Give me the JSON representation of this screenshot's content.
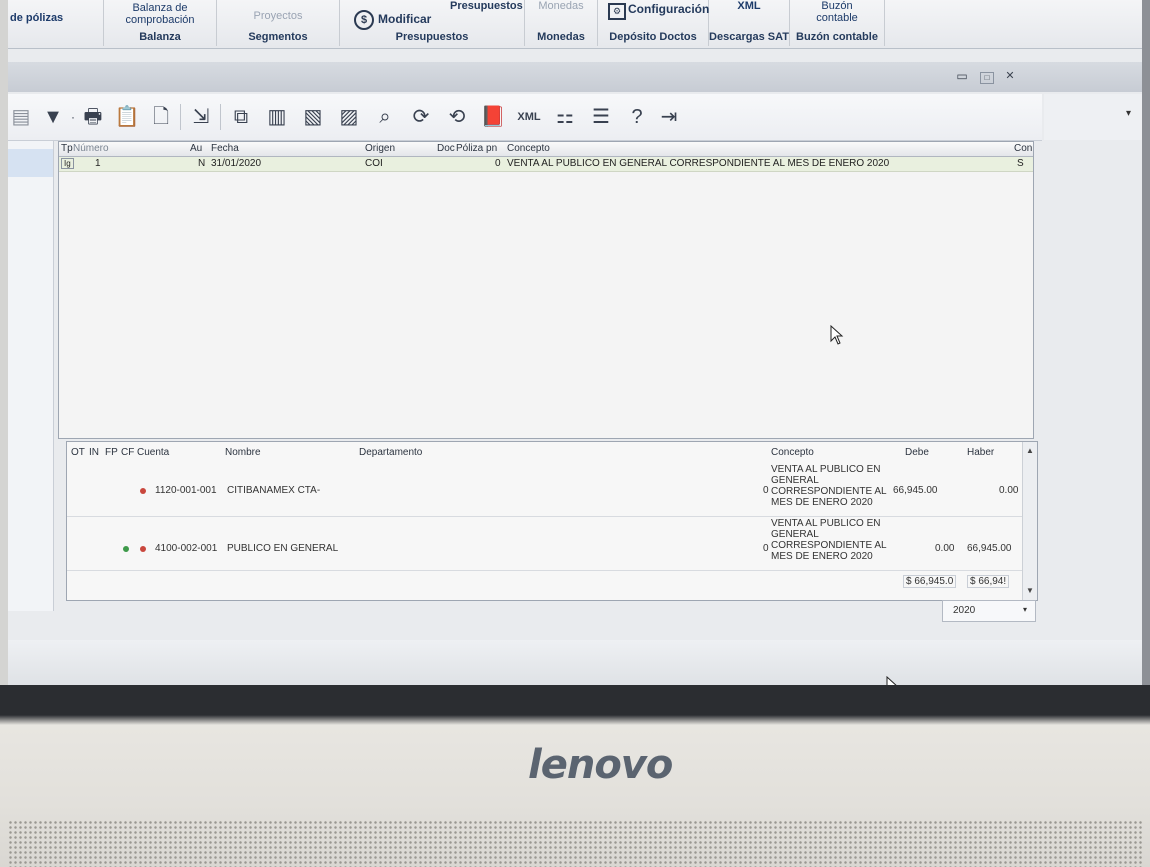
{
  "ribbon": {
    "polizas_label": "de pólizas",
    "balanza_top": "Balanza de comprobación",
    "balanza_bot": "Balanza",
    "proyectos_top": "Proyectos",
    "segmentos_bot": "Segmentos",
    "modificar_label": "Modificar",
    "presupuestos_top": "Presupuestos",
    "presupuestos_bot": "Presupuestos",
    "monedas_top": "Monedas",
    "monedas_bot": "Monedas",
    "configuracion_top": "Configuración",
    "deposito_bot": "Depósito Doctos",
    "xml_top": "XML",
    "descargas_bot": "Descargas SAT",
    "buzon_top": "Buzón contable",
    "buzon_bot": "Buzón contable"
  },
  "polizas_grid": {
    "headers": [
      "Tp",
      "Número",
      "Au",
      "Fecha",
      "Origen",
      "Doc",
      "Póliza pn",
      "Concepto",
      "Con"
    ],
    "row": {
      "tipo": "Ig",
      "numero": "1",
      "au": "N",
      "fecha": "31/01/2020",
      "origen": "COI",
      "poliza": "0",
      "concepto": "VENTA AL PUBLICO EN GENERAL CORRESPONDIENTE AL  MES DE ENERO 2020",
      "con": "S"
    }
  },
  "movimientos_grid": {
    "headers": [
      "OT",
      "IN",
      "FP",
      "CF",
      "Cuenta",
      "Nombre",
      "Departamento",
      "Concepto",
      "Debe",
      "Haber"
    ],
    "rows": [
      {
        "cuenta": "1120-001-001",
        "nombre": "CITIBANAMEX CTA-",
        "prefix": "0",
        "concepto": "VENTA AL PUBLICO EN GENERAL CORRESPONDIENTE AL MES DE ENERO 2020",
        "debe": "66,945.00",
        "haber": "0.00"
      },
      {
        "cuenta": "4100-002-001",
        "nombre": "PUBLICO EN GENERAL",
        "prefix": "0",
        "concepto": "VENTA AL PUBLICO EN GENERAL CORRESPONDIENTE AL MES DE ENERO 2020",
        "debe": "0.00",
        "haber": "66,945.00"
      }
    ],
    "total_debe": "$ 66,945.0",
    "total_haber": "$ 66,94!"
  },
  "year_select": "2020",
  "laptop_brand": "lenovo",
  "colors": {
    "accent_red": "#c9473d",
    "accent_green": "#3e9a4a",
    "row_highlight": "#e9f0df"
  }
}
